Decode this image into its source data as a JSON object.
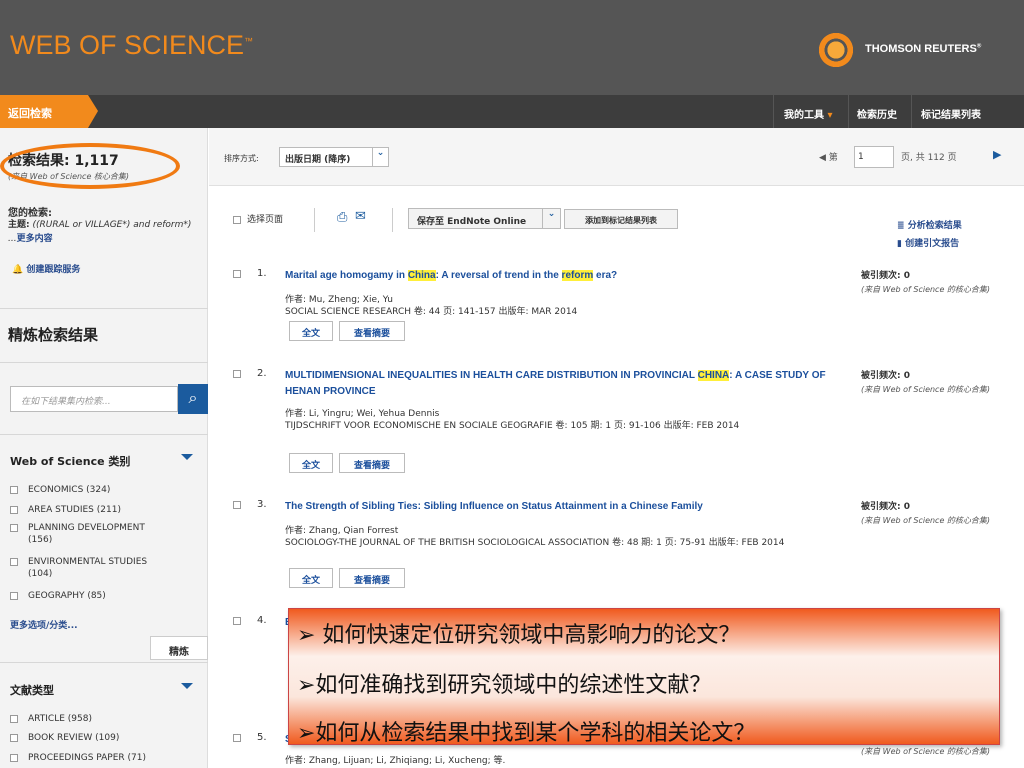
{
  "header": {
    "logo": "WEB OF SCIENCE",
    "logo_tm": "™",
    "publisher": "THOMSON REUTERS",
    "publisher_tm": "®"
  },
  "nav": {
    "back": "返回检索",
    "my_tools": "我的工具",
    "search_history": "检索历史",
    "marked_list": "标记结果列表"
  },
  "sidebar": {
    "results_label": "检索结果: 1,117",
    "results_sub": "(来自 Web of Science 核心合集)",
    "query_label": "您的检索:",
    "query_prefix": "主题:",
    "query_text": "((RURAL or VILLAGE*) and reform*) ...",
    "query_more": "更多内容",
    "create_alert": "创建跟踪服务",
    "refine_title": "精炼检索结果",
    "search_within_placeholder": "在如下结果集内检索...",
    "wos_categories_title": "Web of Science 类别",
    "categories": [
      {
        "label": "ECONOMICS (324)"
      },
      {
        "label": "AREA STUDIES (211)"
      },
      {
        "label": "PLANNING DEVELOPMENT (156)"
      },
      {
        "label": "ENVIRONMENTAL STUDIES (104)"
      },
      {
        "label": "GEOGRAPHY (85)"
      }
    ],
    "more_options": "更多选项/分类...",
    "refine_button": "精炼",
    "doc_types_title": "文献类型",
    "doc_types": [
      {
        "label": "ARTICLE (958)"
      },
      {
        "label": "BOOK REVIEW (109)"
      },
      {
        "label": "PROCEEDINGS PAPER (71)"
      }
    ]
  },
  "sort": {
    "label": "排序方式:",
    "value": "出版日期 (降序)",
    "page_label": "第",
    "page_value": "1",
    "page_total": "页, 共  112  页"
  },
  "toolbar": {
    "select_page": "选择页面",
    "save_endnote": "保存至 EndNote Online",
    "add_marked": "添加到标记结果列表",
    "analyze": "分析检索结果",
    "citation_report": "创建引文报告"
  },
  "records": [
    {
      "num": "1.",
      "title_a": "Marital age homogamy in ",
      "title_hl1": "China",
      "title_b": ": A reversal of trend in the ",
      "title_hl2": "reform",
      "title_c": " era?",
      "authors": "作者: Mu, Zheng; Xie, Yu",
      "source": "SOCIAL SCIENCE RESEARCH  卷: 44  页: 141-157  出版年: MAR 2014",
      "cites": "被引频次: 0",
      "cites_sub": "(来自 Web of Science 的核心合集)"
    },
    {
      "num": "2.",
      "title_a": "MULTIDIMENSIONAL INEQUALITIES IN HEALTH CARE DISTRIBUTION IN PROVINCIAL ",
      "title_hl1": "CHINA",
      "title_b": ": A CASE STUDY OF HENAN PROVINCE",
      "authors": "作者: Li, Yingru; Wei, Yehua Dennis",
      "source": "TIJDSCHRIFT VOOR ECONOMISCHE EN SOCIALE GEOGRAFIE  卷: 105  期: 1  页: 91-106  出版年: FEB 2014",
      "cites": "被引频次: 0",
      "cites_sub": "(来自 Web of Science 的核心合集)"
    },
    {
      "num": "3.",
      "title_a": "The Strength of Sibling Ties: Sibling Influence on Status Attainment in a Chinese Family",
      "authors": "作者: Zhang, Qian Forrest",
      "source": "SOCIOLOGY-THE JOURNAL OF THE BRITISH SOCIOLOGICAL ASSOCIATION  卷: 48  期: 1  页: 75-91  出版年: FEB 2014",
      "cites": "被引频次: 0",
      "cites_sub": "(来自 Web of Science 的核心合集)"
    },
    {
      "num": "4.",
      "title_a": "E"
    },
    {
      "num": "5.",
      "title_a": "S",
      "authors": "作者: Zhang, Lijuan; Li, Zhiqiang; Li, Xucheng; 等.",
      "cites_sub": "(来自 Web of Science 的核心合集)"
    }
  ],
  "record_buttons": {
    "full_text": "全文",
    "abstract": "查看摘要"
  },
  "overlay": {
    "q1": "➢  如何快速定位研究领域中高影响力的论文？",
    "q2": "➢如何准确找到研究领域中的综述性文献？",
    "q3": "➢如何从检索结果中找到某个学科的相关论文？"
  }
}
